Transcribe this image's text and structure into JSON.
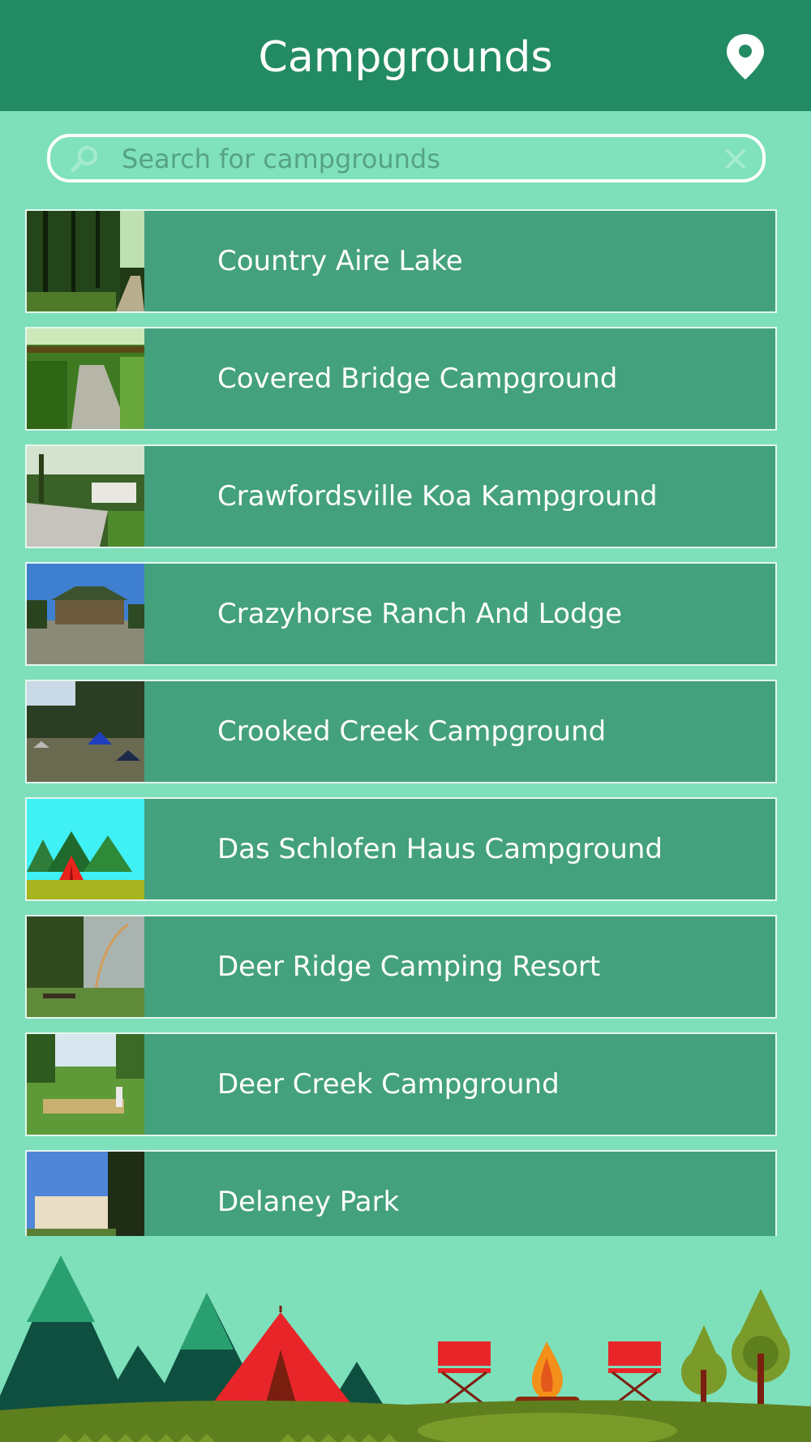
{
  "header": {
    "title": "Campgrounds",
    "map_pin_icon": "map-pin-icon"
  },
  "search": {
    "placeholder": "Search for campgrounds",
    "value": "",
    "search_icon": "magnifier-icon",
    "clear_icon": "close-icon"
  },
  "campgrounds": [
    {
      "name": "Country Aire Lake",
      "photo": "forest-path-photo"
    },
    {
      "name": "Covered Bridge Campground",
      "photo": "tree-lined-road-photo"
    },
    {
      "name": "Crawfordsville Koa Kampground",
      "photo": "rv-campsite-photo"
    },
    {
      "name": "Crazyhorse Ranch And Lodge",
      "photo": "lodge-building-photo"
    },
    {
      "name": "Crooked Creek Campground",
      "photo": "tents-in-field-photo"
    },
    {
      "name": "Das Schlofen Haus Campground",
      "photo": "tent-illustration-placeholder"
    },
    {
      "name": "Deer Ridge Camping Resort",
      "photo": "park-with-rainbow-photo"
    },
    {
      "name": "Deer Creek Campground",
      "photo": "mini-golf-photo"
    },
    {
      "name": "Delaney Park",
      "photo": "park-house-photo"
    }
  ],
  "colors": {
    "header_bg": "#238b63",
    "page_bg": "#7de0bb",
    "row_bg": "#44a17d",
    "row_border": "#e4f7ee",
    "text": "#ffffff"
  }
}
